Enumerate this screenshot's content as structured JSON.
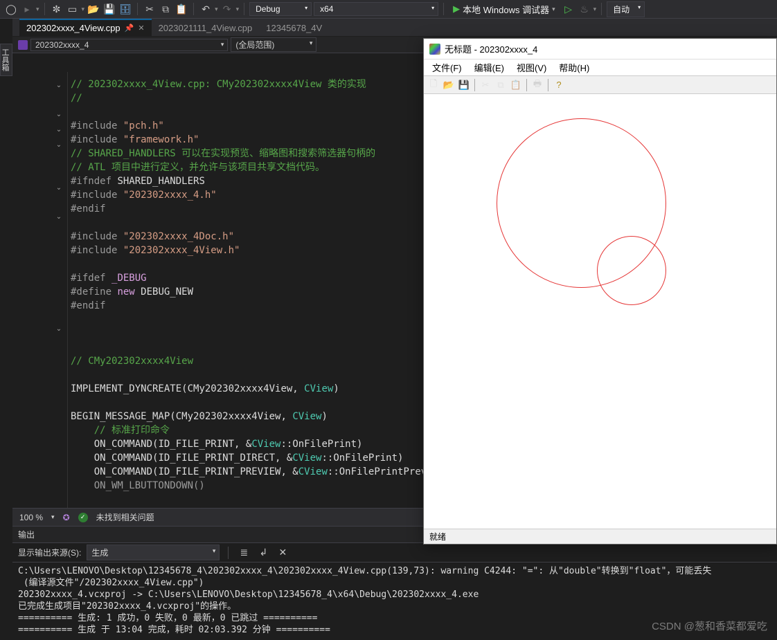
{
  "toolbar": {
    "config_dropdown": "Debug",
    "platform_dropdown": "x64",
    "run_label": "本地 Windows 调试器",
    "auto_label": "自动"
  },
  "side_tab": "工具箱",
  "tabs": [
    {
      "label": "202302xxxx_4View.cpp",
      "active": true
    },
    {
      "label": "2023021111_4View.cpp",
      "active": false
    },
    {
      "label": "12345678_4V",
      "active": false
    }
  ],
  "breadcrumb": {
    "project": "202302xxxx_4",
    "scope": "(全局范围)"
  },
  "code": {
    "l1": "// 202302xxxx_4View.cpp: CMy202302xxxx4View 类的实现",
    "l2": "//",
    "l3a": "#include ",
    "l3b": "\"pch.h\"",
    "l4a": "#include ",
    "l4b": "\"framework.h\"",
    "l5": "// SHARED_HANDLERS 可以在实现预览、缩略图和搜索筛选器句柄的",
    "l6": "// ATL 项目中进行定义，并允许与该项目共享文档代码。",
    "l7a": "#ifndef ",
    "l7b": "SHARED_HANDLERS",
    "l8a": "#include ",
    "l8b": "\"202302xxxx_4.h\"",
    "l9": "#endif",
    "l10a": "#include ",
    "l10b": "\"202302xxxx_4Doc.h\"",
    "l11a": "#include ",
    "l11b": "\"202302xxxx_4View.h\"",
    "l12a": "#ifdef ",
    "l12b": "_DEBUG",
    "l13a": "#define ",
    "l13b": "new",
    "l13c": " DEBUG_NEW",
    "l14": "#endif",
    "l15": "// CMy202302xxxx4View",
    "l16a": "IMPLEMENT_DYNCREATE",
    "l16b": "(CMy202302xxxx4View, ",
    "l16c": "CView",
    "l16d": ")",
    "l17a": "BEGIN_MESSAGE_MAP",
    "l17b": "(CMy202302xxxx4View, ",
    "l17c": "CView",
    "l17d": ")",
    "l18": "// 标准打印命令",
    "l19a": "ON_COMMAND",
    "l19b": "(ID_FILE_PRINT, &",
    "l19c": "CView",
    "l19d": "::OnFilePrint)",
    "l20a": "ON_COMMAND",
    "l20b": "(ID_FILE_PRINT_DIRECT, &",
    "l20c": "CView",
    "l20d": "::OnFilePrint)",
    "l21a": "ON_COMMAND",
    "l21b": "(ID_FILE_PRINT_PREVIEW, &",
    "l21c": "CView",
    "l21d": "::OnFilePrintPreview",
    "l22": "ON_WM_LBUTTONDOWN()"
  },
  "footer": {
    "zoom": "100 %",
    "issues": "未找到相关问题"
  },
  "output": {
    "title": "输出",
    "source_label": "显示输出来源(S):",
    "source_value": "生成",
    "lines": [
      "C:\\Users\\LENOVO\\Desktop\\12345678_4\\202302xxxx_4\\202302xxxx_4View.cpp(139,73): warning C4244: \"=\": 从\"double\"转换到\"float\"，可能丢失",
      " (编译源文件\"/202302xxxx_4View.cpp\")",
      "202302xxxx_4.vcxproj -> C:\\Users\\LENOVO\\Desktop\\12345678_4\\x64\\Debug\\202302xxxx_4.exe",
      "已完成生成项目\"202302xxxx_4.vcxproj\"的操作。",
      "========== 生成: 1 成功，0 失败，0 最新，0 已跳过 ==========",
      "========== 生成 于 13:04 完成，耗时 02:03.392 分钟 =========="
    ]
  },
  "app": {
    "title": "无标题 - 202302xxxx_4",
    "menu": {
      "file": "文件(F)",
      "edit": "编辑(E)",
      "view": "视图(V)",
      "help": "帮助(H)"
    },
    "status": "就绪"
  },
  "watermark": "CSDN @葱和香菜都爱吃"
}
